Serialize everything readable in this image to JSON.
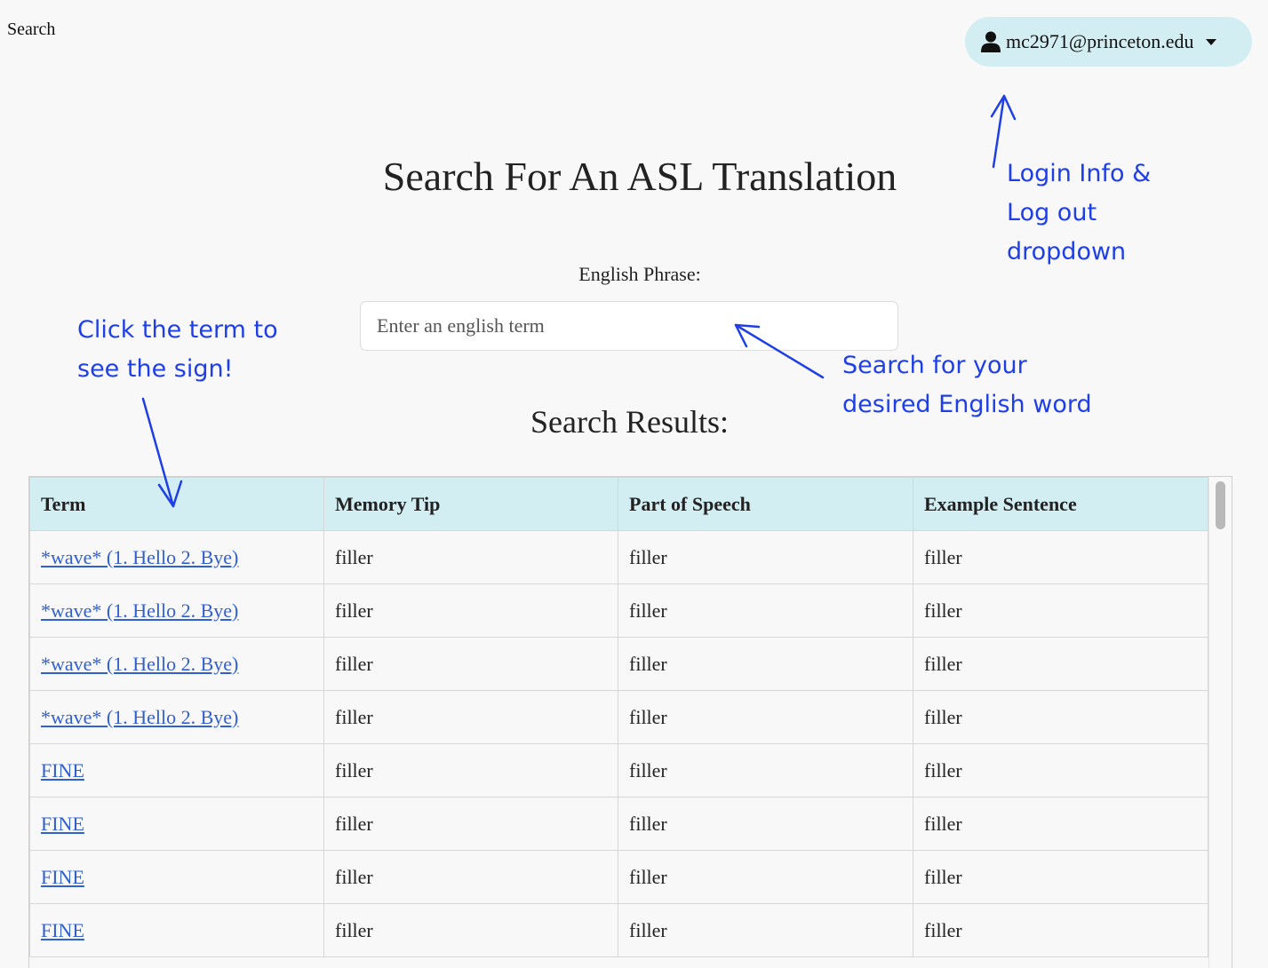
{
  "nav": {
    "label": "Search"
  },
  "user": {
    "email": "mc2971@princeton.edu"
  },
  "page": {
    "title": "Search For An ASL Translation",
    "phrase_label": "English Phrase:",
    "search_placeholder": "Enter an english term",
    "results_label": "Search Results:"
  },
  "table": {
    "headers": [
      "Term",
      "Memory Tip",
      "Part of Speech",
      "Example Sentence"
    ],
    "rows": [
      [
        "*wave* (1. Hello 2. Bye)",
        "filler",
        "filler",
        "filler"
      ],
      [
        "*wave* (1. Hello 2. Bye)",
        "filler",
        "filler",
        "filler"
      ],
      [
        "*wave* (1. Hello 2. Bye)",
        "filler",
        "filler",
        "filler"
      ],
      [
        "*wave* (1. Hello 2. Bye)",
        "filler",
        "filler",
        "filler"
      ],
      [
        "FINE",
        "filler",
        "filler",
        "filler"
      ],
      [
        "FINE",
        "filler",
        "filler",
        "filler"
      ],
      [
        "FINE",
        "filler",
        "filler",
        "filler"
      ],
      [
        "FINE",
        "filler",
        "filler",
        "filler"
      ]
    ]
  },
  "annotations": {
    "login": "Login Info &\nLog out\ndropdown",
    "click_term": "Click the term to\nsee the sign!",
    "search_word": "Search for your\ndesired English word"
  },
  "colors": {
    "accent_bg": "#d3eef2",
    "link": "#2f5fd0",
    "annotation": "#1f3fe6"
  }
}
